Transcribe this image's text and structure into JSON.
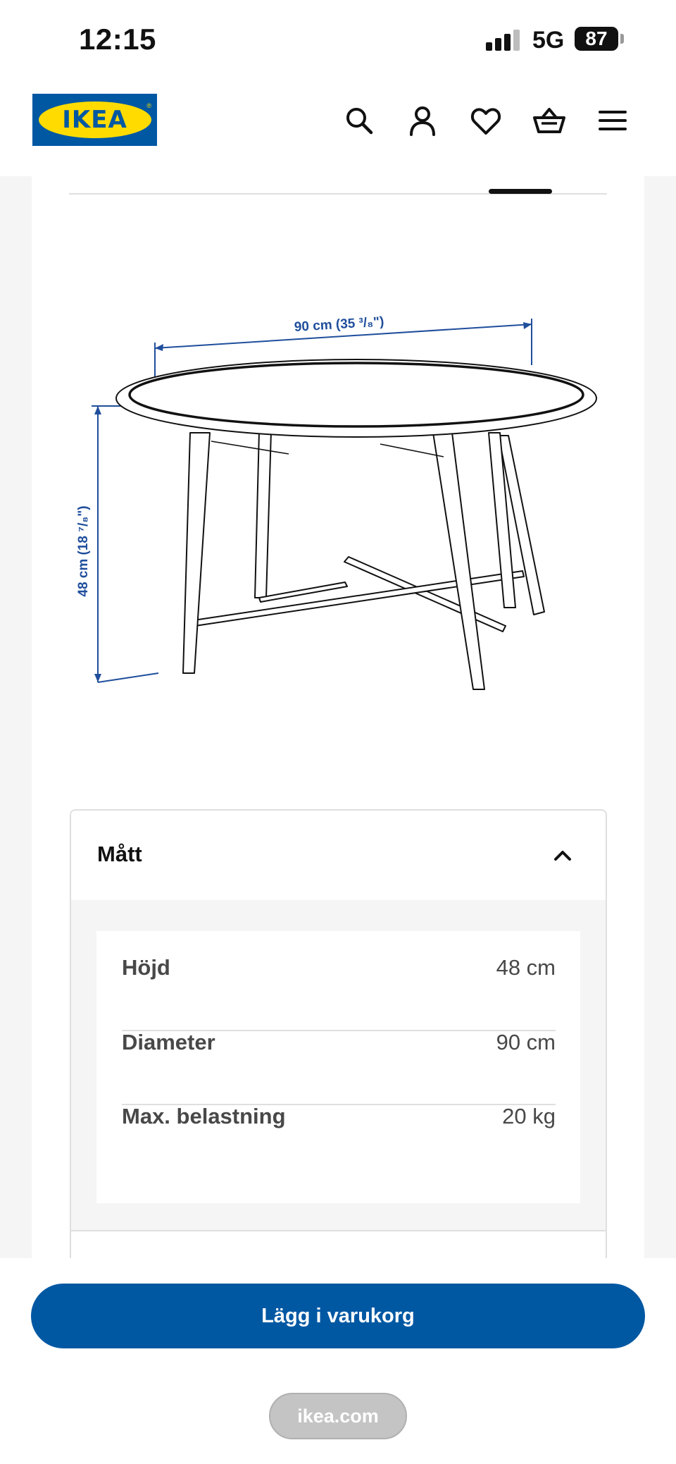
{
  "status_bar": {
    "time": "12:15",
    "network": "5G",
    "battery": "87"
  },
  "header": {
    "logo_text": "IKEA"
  },
  "diagram": {
    "width_label": "90 cm (35 ³/₈\")",
    "height_label": "48 cm (18 ⁷/₈\")"
  },
  "measurements": {
    "title": "Mått",
    "rows": [
      {
        "label": "Höjd",
        "value": "48 cm"
      },
      {
        "label": "Diameter",
        "value": "90 cm"
      },
      {
        "label": "Max. belastning",
        "value": "20 kg"
      }
    ]
  },
  "actions": {
    "add_to_cart": "Lägg i varukorg"
  },
  "browser": {
    "url": "ikea.com"
  },
  "colors": {
    "brand_blue": "#0058a3",
    "brand_yellow": "#ffdb00",
    "dimension_blue": "#1f4e9c"
  }
}
